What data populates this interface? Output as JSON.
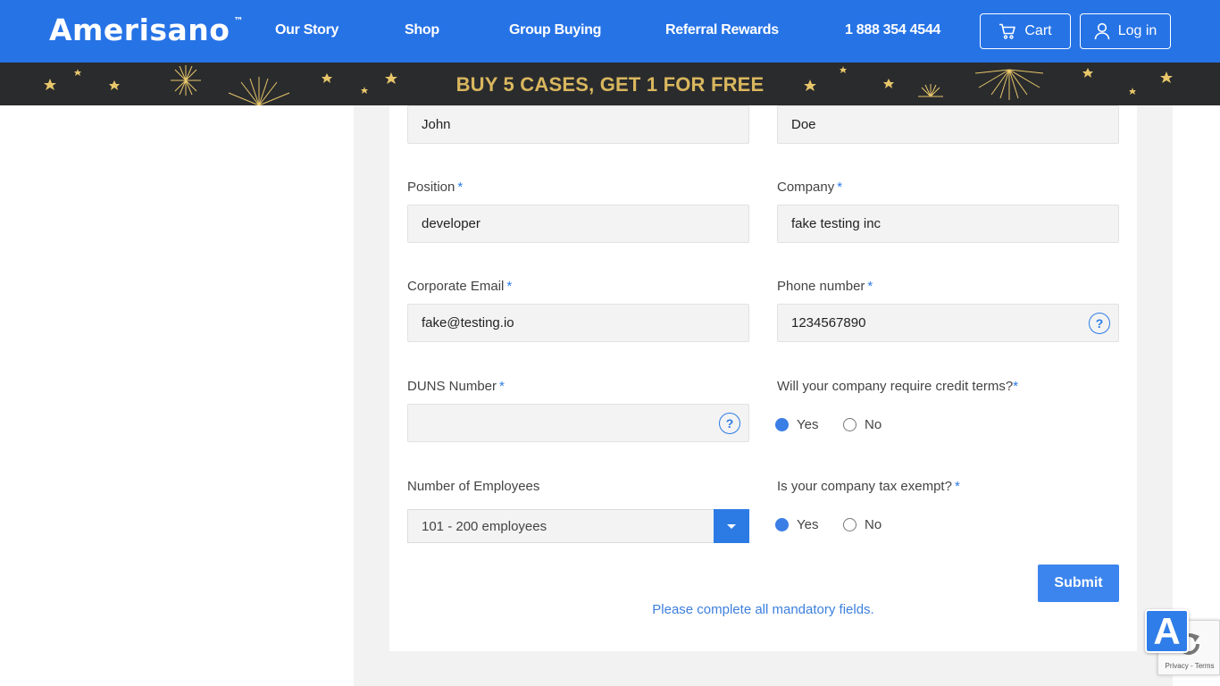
{
  "header": {
    "logo": "Amerisano",
    "logo_mark": "™",
    "nav": [
      "Our Story",
      "Shop",
      "Group Buying",
      "Referral Rewards"
    ],
    "phone": "1 888 354 4544",
    "cart_label": "Cart",
    "login_label": "Log in",
    "icons": {
      "cart": "cart-icon",
      "login": "user-icon"
    },
    "color": "#2673e6"
  },
  "promo": {
    "text": "BUY 5 CASES, GET 1 FOR FREE",
    "text_color": "#d9b75e",
    "background": "#2a2b2d"
  },
  "form": {
    "first_name_value": "John",
    "last_name_value": "Doe",
    "position": {
      "label": "Position",
      "required_mark": "*",
      "value": "developer"
    },
    "company": {
      "label": "Company",
      "required_mark": "*",
      "value": "fake testing inc"
    },
    "email": {
      "label": "Corporate Email",
      "required_mark": "*",
      "value": "fake@testing.io"
    },
    "phone": {
      "label": "Phone number",
      "required_mark": "*",
      "value": "1234567890",
      "help": "?"
    },
    "duns": {
      "label": "DUNS Number",
      "required_mark": "*",
      "value": "",
      "help": "?"
    },
    "credit_terms": {
      "label": "Will your company require credit terms?",
      "required_mark": "*",
      "options": [
        "Yes",
        "No"
      ],
      "selected": "Yes"
    },
    "employees": {
      "label": "Number of Employees",
      "selected": "101 - 200 employees"
    },
    "tax_exempt": {
      "label": "Is your company tax exempt?",
      "required_mark": "*",
      "options": [
        "Yes",
        "No"
      ],
      "selected": "Yes"
    },
    "submit_label": "Submit",
    "validation_message": "Please complete all mandatory fields.",
    "accent": "#2c7be5"
  },
  "widgets": {
    "recaptcha_links": "Privacy - Terms",
    "accessibility_label": "A"
  }
}
